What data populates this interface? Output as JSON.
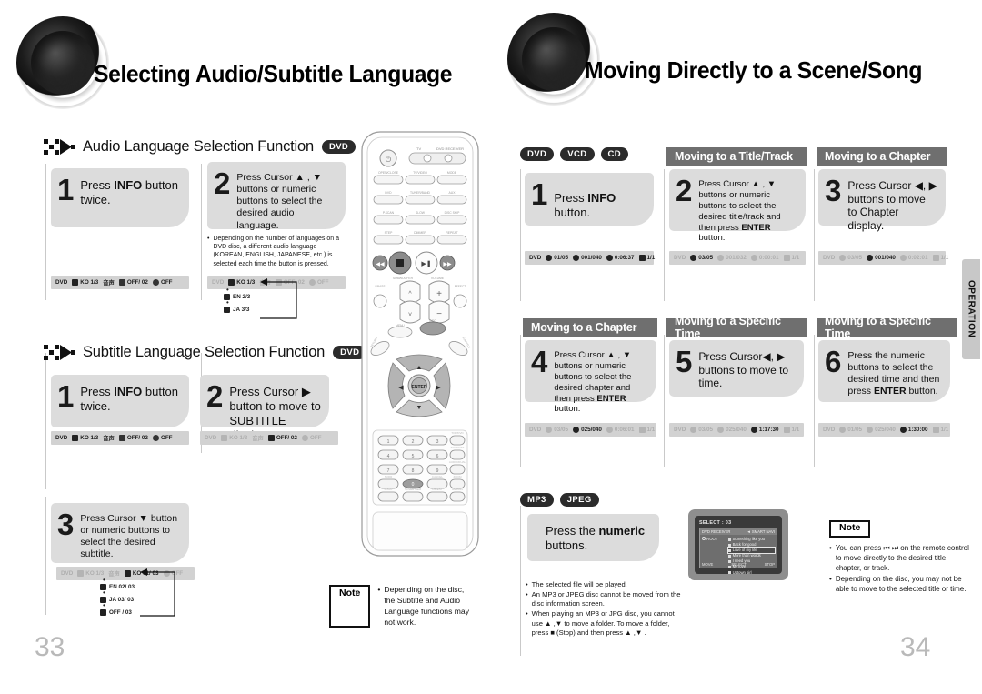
{
  "left_page": {
    "title": "Selecting Audio/Subtitle Language",
    "page_number": "33",
    "sections": [
      {
        "label": "Audio Language Selection Function",
        "disc": "DVD",
        "steps": [
          {
            "num": "1",
            "text_html": "Press <b>INFO</b> button twice."
          },
          {
            "num": "2",
            "text_html": "Press Cursor ▲ , ▼ buttons or numeric buttons to select the desired audio language."
          }
        ],
        "note_inline": "Depending on the number of languages on a DVD disc, a different audio language (KOREAN, ENGLISH, JAPANESE, etc.) is selected each time the button is pressed.",
        "osd_1": {
          "disc": "DVD",
          "audio": "KO 1/3",
          "subtitle": "音声",
          "sub2": "OFF/ 02",
          "repeat": "OFF"
        },
        "osd_2": {
          "disc": "DVD",
          "audio": "KO 1/3",
          "subtitle": "音声",
          "sub2": "OFF/ 02",
          "repeat": "OFF"
        },
        "dropdown": [
          "KO 1/3",
          "EN 2/3",
          "JA 3/3"
        ]
      },
      {
        "label": "Subtitle Language Selection Function",
        "disc": "DVD",
        "steps": [
          {
            "num": "1",
            "text_html": "Press <b>INFO</b> button twice."
          },
          {
            "num": "2",
            "text_html": "Press Cursor ▶ button to move to SUBTITLE display."
          },
          {
            "num": "3",
            "text_html": "Press Cursor ▼ button or numeric buttons to select the desired subtitle."
          }
        ],
        "osd_1": {
          "disc": "DVD",
          "audio": "KO 1/3",
          "sub2": "OFF/ 02",
          "repeat": "OFF"
        },
        "osd_2": {
          "disc": "DVD",
          "audio": "KO 1/3",
          "sub2": "OFF/ 02",
          "repeat": "OFF"
        },
        "osd_3": {
          "disc": "DVD",
          "audio": "KO 1/3",
          "sub2": "KO 01/ 03",
          "repeat": "OFF"
        },
        "dropdown": [
          "KO 01/ 03",
          "EN 02/ 03",
          "JA 03/ 03",
          "OFF / 03"
        ]
      }
    ],
    "note": {
      "tag": "Note",
      "items": [
        "Depending on the disc, the Subtitle and Audio Language functions may not work."
      ]
    }
  },
  "right_page": {
    "title": "Moving Directly to a Scene/Song",
    "page_number": "34",
    "side_tab": "OPERATION",
    "discs": [
      "DVD",
      "VCD",
      "CD"
    ],
    "headers": {
      "title_track": "Moving to a Title/Track",
      "chapter": "Moving to a Chapter",
      "chapter2": "Moving to a Chapter",
      "time": "Moving to a Specific Time",
      "time2": "Moving to a Specific Time"
    },
    "steps": [
      {
        "num": "1",
        "text_html": "Press <b>INFO</b> button.",
        "osd": {
          "disc": "DVD",
          "title": "01/05",
          "chapter": "001/040",
          "time": "0:06:37",
          "audio": "1/1"
        }
      },
      {
        "num": "2",
        "text_html": "Press Cursor ▲ , ▼ buttons or numeric buttons to select the desired title/track and then press <b>ENTER</b> button.",
        "osd": {
          "disc": "DVD",
          "title": "03/05",
          "chapter": "001/032",
          "time": "0:00:01",
          "audio": "1/1"
        }
      },
      {
        "num": "3",
        "text_html": "Press Cursor ◀, ▶ buttons to move to Chapter display.",
        "osd": {
          "disc": "DVD",
          "title": "03/05",
          "chapter": "001/040",
          "time": "0:02:01",
          "audio": "1/1"
        }
      },
      {
        "num": "4",
        "text_html": "Press Cursor ▲ , ▼ buttons or numeric buttons to select the desired chapter and then press <b>ENTER</b> button.",
        "osd": {
          "disc": "DVD",
          "title": "03/05",
          "chapter": "025/040",
          "time": "0:06:01",
          "audio": "1/1"
        }
      },
      {
        "num": "5",
        "text_html": "Press Cursor◀, ▶ buttons to move to time.",
        "osd": {
          "disc": "DVD",
          "title": "03/05",
          "chapter": "025/040",
          "time": "1:17:30",
          "audio": "1/1"
        }
      },
      {
        "num": "6",
        "text_html": "Press the numeric buttons to select the desired time and then press <b>ENTER</b> button.",
        "osd": {
          "disc": "DVD",
          "title": "01/05",
          "chapter": "025/040",
          "time": "1:30:00",
          "audio": "1/1"
        }
      }
    ],
    "mp3_section": {
      "discs": [
        "MP3",
        "JPEG"
      ],
      "step_html": "Press the <b>numeric</b> buttons.",
      "bullets": [
        "The selected file will be played.",
        "An MP3 or JPEG disc cannot be moved from the disc information screen.",
        "When playing an MP3 or JPG disc, you cannot use ▲ ,▼  to move a folder. To move a folder, press ■ (Stop) and then press ▲ ,▼ ."
      ]
    },
    "tv_screen": {
      "select_label": "SELECT :",
      "select_value": "03",
      "panel_left": "DVD RECEIVER",
      "panel_right": "◄ SMART NAVI",
      "folder": "ROOT",
      "songs": [
        "Something like you",
        "Back for good",
        "Love of my life",
        "More than words",
        "I need you",
        "My love",
        "Uptown girl"
      ],
      "selected_index": 2,
      "foot": [
        "MOVE",
        "SELECT",
        "STOP"
      ]
    },
    "note": {
      "tag": "Note",
      "items": [
        "You can press ⏮ ⏭ on the remote control to move directly to the desired title, chapter, or track.",
        "Depending on the disc, you may not be able to move to the selected title or time."
      ]
    }
  },
  "remote": {
    "power_label": "⏻",
    "top_labels": [
      "TV",
      "DVD RECEIVER"
    ],
    "rows": [
      [
        "OPEN/CLOSE",
        "TV/VIDEO",
        "MODE"
      ],
      [
        "DVD",
        "TUNER/BAND",
        "AUX"
      ],
      [
        "P.SCAN",
        "SLOW",
        "DISC SKIP"
      ],
      [
        "STEP",
        "DIMMER",
        "REPEAT"
      ]
    ],
    "transport": [
      "◀◀",
      "■",
      "▶‖",
      "▶▶"
    ],
    "mid_labels": [
      "SUBWOOFER",
      "VOLUME"
    ],
    "side_labels": [
      "P.BASS / LOGIC",
      "P.BASS EFFECT"
    ],
    "nav_labels": [
      "MENU",
      "ENTER",
      "INFO",
      "RETURN",
      "SUB TITLE"
    ],
    "numbers": [
      "1",
      "2",
      "3",
      "4",
      "5",
      "6",
      "7",
      "8",
      "9",
      "0"
    ],
    "num_side": [
      "TOP/DVD",
      "SOUND/DI",
      "AUDIO/DUAL",
      "ZOOM"
    ],
    "num_bottom": [
      "SURR",
      "CANCEL",
      "LOGO",
      "TUNER MEM",
      "DIGEST",
      "REMAIN"
    ]
  }
}
